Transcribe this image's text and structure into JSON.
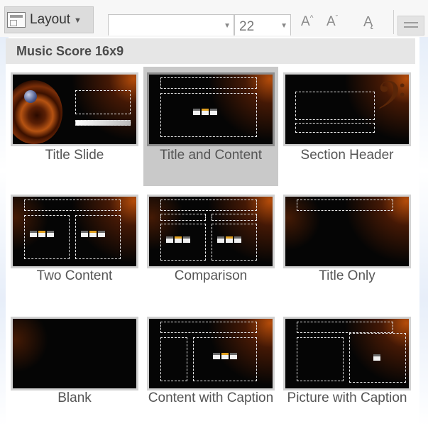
{
  "ribbon": {
    "layout_label": "Layout",
    "font_name": "",
    "font_size": "22",
    "grow_font": "A",
    "shrink_font": "A"
  },
  "gallery": {
    "theme_name": "Music Score 16x9",
    "layouts": [
      {
        "name": "Title Slide",
        "selected": false
      },
      {
        "name": "Title and Content",
        "selected": true
      },
      {
        "name": "Section Header",
        "selected": false
      },
      {
        "name": "Two Content",
        "selected": false
      },
      {
        "name": "Comparison",
        "selected": false
      },
      {
        "name": "Title Only",
        "selected": false
      },
      {
        "name": "Blank",
        "selected": false
      },
      {
        "name": "Content with Caption",
        "selected": false
      },
      {
        "name": "Picture with Caption",
        "selected": false
      }
    ]
  },
  "icons": {
    "layout": "layout-icon",
    "dropdown": "chevron-down-icon",
    "grow": "grow-font-icon",
    "shrink": "shrink-font-icon",
    "clear": "clear-formatting-icon"
  },
  "colors": {
    "thumb_bg": "#050505",
    "accent_orange": "#b65312",
    "selection": "#c9c9c9",
    "header_bg": "#e6e6e6"
  }
}
